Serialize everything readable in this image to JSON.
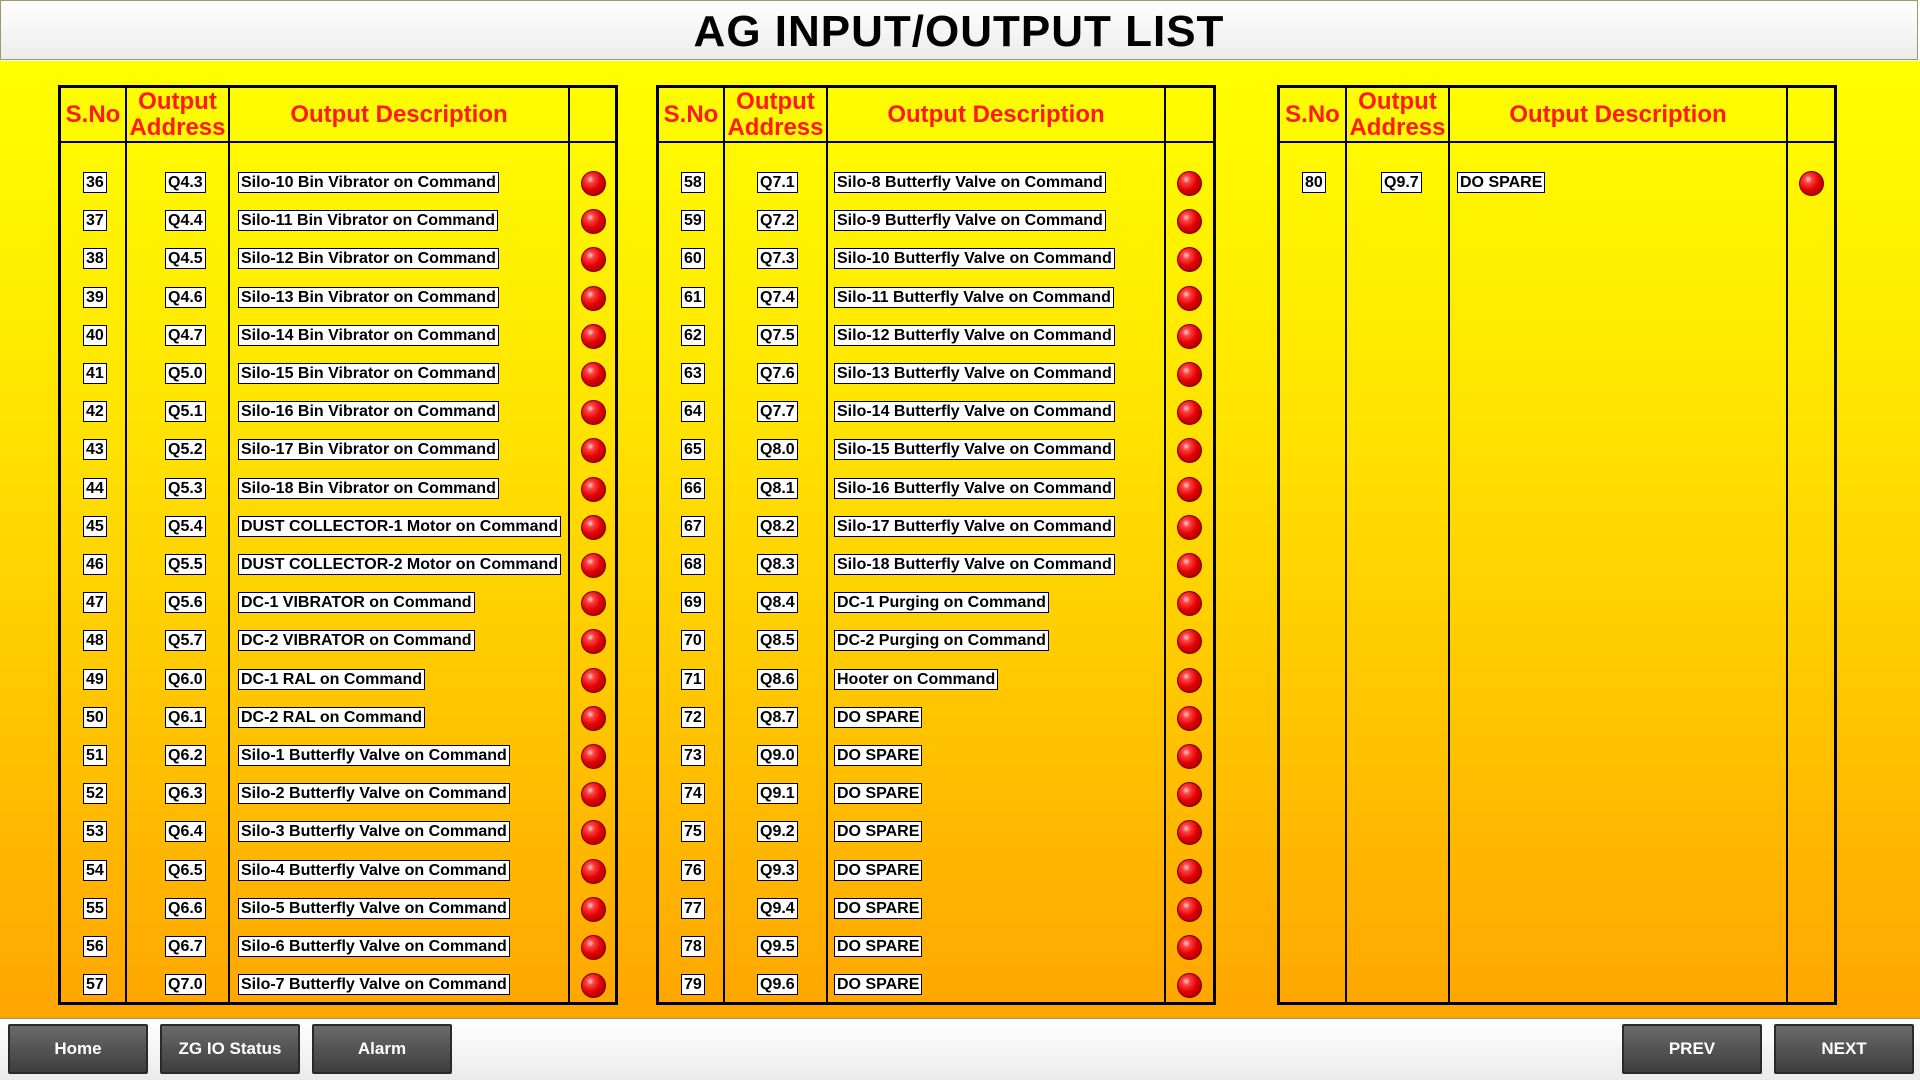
{
  "title": "AG INPUT/OUTPUT LIST",
  "headers": {
    "sno": "S.No",
    "address": "Output Address",
    "description": "Output Description"
  },
  "panels": [
    {
      "rows": [
        {
          "sno": "36",
          "address": "Q4.3",
          "description": "Silo-10 Bin Vibrator on Command",
          "status": "off"
        },
        {
          "sno": "37",
          "address": "Q4.4",
          "description": "Silo-11 Bin Vibrator on Command",
          "status": "off"
        },
        {
          "sno": "38",
          "address": "Q4.5",
          "description": "Silo-12 Bin Vibrator on Command",
          "status": "off"
        },
        {
          "sno": "39",
          "address": "Q4.6",
          "description": "Silo-13 Bin Vibrator on Command",
          "status": "off"
        },
        {
          "sno": "40",
          "address": "Q4.7",
          "description": "Silo-14 Bin Vibrator on Command",
          "status": "off"
        },
        {
          "sno": "41",
          "address": "Q5.0",
          "description": "Silo-15 Bin Vibrator on Command",
          "status": "off"
        },
        {
          "sno": "42",
          "address": "Q5.1",
          "description": "Silo-16 Bin Vibrator on Command",
          "status": "off"
        },
        {
          "sno": "43",
          "address": "Q5.2",
          "description": "Silo-17 Bin Vibrator on Command",
          "status": "off"
        },
        {
          "sno": "44",
          "address": "Q5.3",
          "description": "Silo-18 Bin Vibrator on Command",
          "status": "off"
        },
        {
          "sno": "45",
          "address": "Q5.4",
          "description": "DUST COLLECTOR-1 Motor on Command",
          "status": "off"
        },
        {
          "sno": "46",
          "address": "Q5.5",
          "description": "DUST COLLECTOR-2 Motor on Command",
          "status": "off"
        },
        {
          "sno": "47",
          "address": "Q5.6",
          "description": "DC-1 VIBRATOR on Command",
          "status": "off"
        },
        {
          "sno": "48",
          "address": "Q5.7",
          "description": "DC-2 VIBRATOR on Command",
          "status": "off"
        },
        {
          "sno": "49",
          "address": "Q6.0",
          "description": "DC-1 RAL on Command",
          "status": "off"
        },
        {
          "sno": "50",
          "address": "Q6.1",
          "description": "DC-2 RAL on Command",
          "status": "off"
        },
        {
          "sno": "51",
          "address": "Q6.2",
          "description": "Silo-1 Butterfly Valve on Command",
          "status": "off"
        },
        {
          "sno": "52",
          "address": "Q6.3",
          "description": "Silo-2 Butterfly Valve on Command",
          "status": "off"
        },
        {
          "sno": "53",
          "address": "Q6.4",
          "description": "Silo-3 Butterfly Valve on Command",
          "status": "off"
        },
        {
          "sno": "54",
          "address": "Q6.5",
          "description": "Silo-4 Butterfly Valve on Command",
          "status": "off"
        },
        {
          "sno": "55",
          "address": "Q6.6",
          "description": "Silo-5 Butterfly Valve on Command",
          "status": "off"
        },
        {
          "sno": "56",
          "address": "Q6.7",
          "description": "Silo-6 Butterfly Valve on Command",
          "status": "off"
        },
        {
          "sno": "57",
          "address": "Q7.0",
          "description": "Silo-7 Butterfly Valve on Command",
          "status": "off"
        }
      ]
    },
    {
      "rows": [
        {
          "sno": "58",
          "address": "Q7.1",
          "description": "Silo-8 Butterfly Valve on Command",
          "status": "off"
        },
        {
          "sno": "59",
          "address": "Q7.2",
          "description": "Silo-9 Butterfly Valve on Command",
          "status": "off"
        },
        {
          "sno": "60",
          "address": "Q7.3",
          "description": "Silo-10 Butterfly Valve on Command",
          "status": "off"
        },
        {
          "sno": "61",
          "address": "Q7.4",
          "description": "Silo-11 Butterfly Valve on Command",
          "status": "off"
        },
        {
          "sno": "62",
          "address": "Q7.5",
          "description": "Silo-12 Butterfly Valve on Command",
          "status": "off"
        },
        {
          "sno": "63",
          "address": "Q7.6",
          "description": "Silo-13 Butterfly Valve on Command",
          "status": "off"
        },
        {
          "sno": "64",
          "address": "Q7.7",
          "description": "Silo-14 Butterfly Valve on Command",
          "status": "off"
        },
        {
          "sno": "65",
          "address": "Q8.0",
          "description": "Silo-15 Butterfly Valve on Command",
          "status": "off"
        },
        {
          "sno": "66",
          "address": "Q8.1",
          "description": "Silo-16 Butterfly Valve on Command",
          "status": "off"
        },
        {
          "sno": "67",
          "address": "Q8.2",
          "description": "Silo-17 Butterfly Valve on Command",
          "status": "off"
        },
        {
          "sno": "68",
          "address": "Q8.3",
          "description": "Silo-18 Butterfly Valve on Command",
          "status": "off"
        },
        {
          "sno": "69",
          "address": "Q8.4",
          "description": "DC-1 Purging on Command",
          "status": "off"
        },
        {
          "sno": "70",
          "address": "Q8.5",
          "description": "DC-2 Purging on Command",
          "status": "off"
        },
        {
          "sno": "71",
          "address": "Q8.6",
          "description": "Hooter on Command",
          "status": "off"
        },
        {
          "sno": "72",
          "address": "Q8.7",
          "description": "DO SPARE",
          "status": "off"
        },
        {
          "sno": "73",
          "address": "Q9.0",
          "description": "DO SPARE",
          "status": "off"
        },
        {
          "sno": "74",
          "address": "Q9.1",
          "description": "DO SPARE",
          "status": "off"
        },
        {
          "sno": "75",
          "address": "Q9.2",
          "description": "DO SPARE",
          "status": "off"
        },
        {
          "sno": "76",
          "address": "Q9.3",
          "description": "DO SPARE",
          "status": "off"
        },
        {
          "sno": "77",
          "address": "Q9.4",
          "description": "DO SPARE",
          "status": "off"
        },
        {
          "sno": "78",
          "address": "Q9.5",
          "description": "DO SPARE",
          "status": "off"
        },
        {
          "sno": "79",
          "address": "Q9.6",
          "description": "DO SPARE",
          "status": "off"
        }
      ]
    },
    {
      "rows": [
        {
          "sno": "80",
          "address": "Q9.7",
          "description": "DO SPARE",
          "status": "off"
        }
      ]
    }
  ],
  "indicator": {
    "icon": "red-lamp-icon",
    "off_color": "#e00000"
  },
  "footer": {
    "home": "Home",
    "zg_io_status": "ZG IO Status",
    "alarm": "Alarm",
    "prev": "PREV",
    "next": "NEXT"
  },
  "colors": {
    "background_top": "#ffff00",
    "background_bottom": "#ffa500",
    "header_text": "#ff1a1a",
    "button": "#4f4f4f"
  }
}
